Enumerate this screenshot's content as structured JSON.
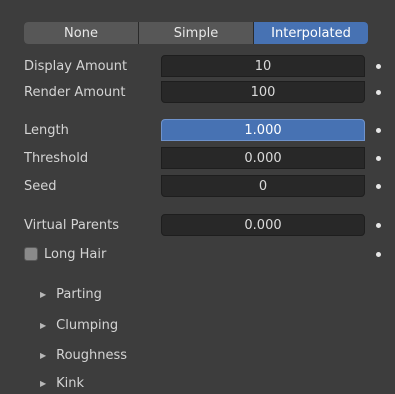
{
  "mode_tabs": [
    {
      "label": "None",
      "active": false
    },
    {
      "label": "Simple",
      "active": false
    },
    {
      "label": "Interpolated",
      "active": true
    }
  ],
  "fields": {
    "display_amount": {
      "label": "Display Amount",
      "value": "10"
    },
    "render_amount": {
      "label": "Render Amount",
      "value": "100"
    },
    "length": {
      "label": "Length",
      "value": "1.000"
    },
    "threshold": {
      "label": "Threshold",
      "value": "0.000"
    },
    "seed": {
      "label": "Seed",
      "value": "0"
    },
    "virtual_parents": {
      "label": "Virtual Parents",
      "value": "0.000"
    }
  },
  "long_hair": {
    "label": "Long Hair",
    "checked": false
  },
  "subpanels": [
    "Parting",
    "Clumping",
    "Roughness",
    "Kink"
  ],
  "colors": {
    "accent": "#4772b3",
    "background": "#3d3d3d",
    "field": "#282828"
  }
}
